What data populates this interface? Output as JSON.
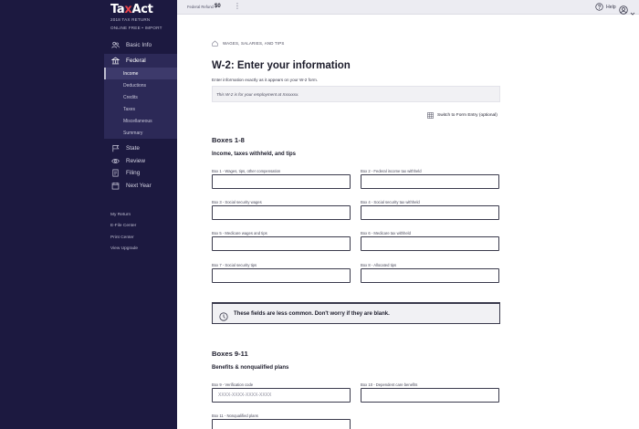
{
  "brand": {
    "logo_t": "T",
    "logo_a": "a",
    "logo_x": "x",
    "logo_act": "Act",
    "line1": "2018 TAX RETURN",
    "line2": "ONLINE FREE • IMPORT"
  },
  "sidebar": {
    "basic_info": "Basic Info",
    "federal": "Federal",
    "sub_items": [
      "Income",
      "Deductions",
      "Credits",
      "Taxes",
      "Miscellaneous",
      "Summary"
    ],
    "state": "State",
    "review": "Review",
    "filing": "Filing",
    "next_year": "Next Year",
    "links": [
      "My Return",
      "E-File Center",
      "Print Center",
      "View Upgrade"
    ]
  },
  "topbar": {
    "refund_label": "Federal Refund",
    "refund_value": "$0",
    "kebab": "⋮",
    "help": "Help"
  },
  "main": {
    "breadcrumb": "WAGES, SALARIES, AND TIPS",
    "title": "W-2: Enter your information",
    "intro": "Enter information exactly as it appears on your W-2 form.",
    "notice": "This W-2 is for your employment at Xxxxxxx.",
    "switch_label": "Switch to Form Entry (optional)",
    "section1_title": "Boxes 1-8",
    "section1_sub": "Income, taxes withheld, and tips",
    "fields1": [
      {
        "label": "Box 1 - Wages, tips, other compensation",
        "value": ""
      },
      {
        "label": "Box 2 - Federal income tax withheld",
        "value": ""
      },
      {
        "label": "Box 3 - Social security wages",
        "value": ""
      },
      {
        "label": "Box 4 - Social security tax withheld",
        "value": ""
      },
      {
        "label": "Box 5 - Medicare wages and tips",
        "value": ""
      },
      {
        "label": "Box 6 - Medicare tax withheld",
        "value": ""
      },
      {
        "label": "Box 7 - Social security tips",
        "value": ""
      },
      {
        "label": "Box 8 - Allocated tips",
        "value": ""
      }
    ],
    "banner": "These fields are less common. Don't worry if they are blank.",
    "section2_title": "Boxes 9-11",
    "section2_sub": "Benefits & nonqualified plans",
    "fields2": [
      {
        "label": "Box 9 - Verification code",
        "value": "",
        "placeholder": "XXXX-XXXX-XXXX-XXXX"
      },
      {
        "label": "Box 10 - Dependent care benefits",
        "value": ""
      },
      {
        "label": "Box 11 - Nonqualified plans",
        "value": ""
      }
    ]
  },
  "colors": {
    "sidebar_bg": "#1c1940",
    "sidebar_active": "#2c2957",
    "logo_accent": "#e8424a",
    "text_dark": "#1d1d2c"
  },
  "icons": {
    "basic_info": "people-icon",
    "federal": "capitol-icon",
    "state": "flag-icon",
    "review": "eye-icon",
    "filing": "folder-icon",
    "next_year": "calendar-icon",
    "help": "question-circle-icon",
    "account": "user-circle-icon",
    "info": "clock-icon",
    "switch": "grid-icon"
  }
}
